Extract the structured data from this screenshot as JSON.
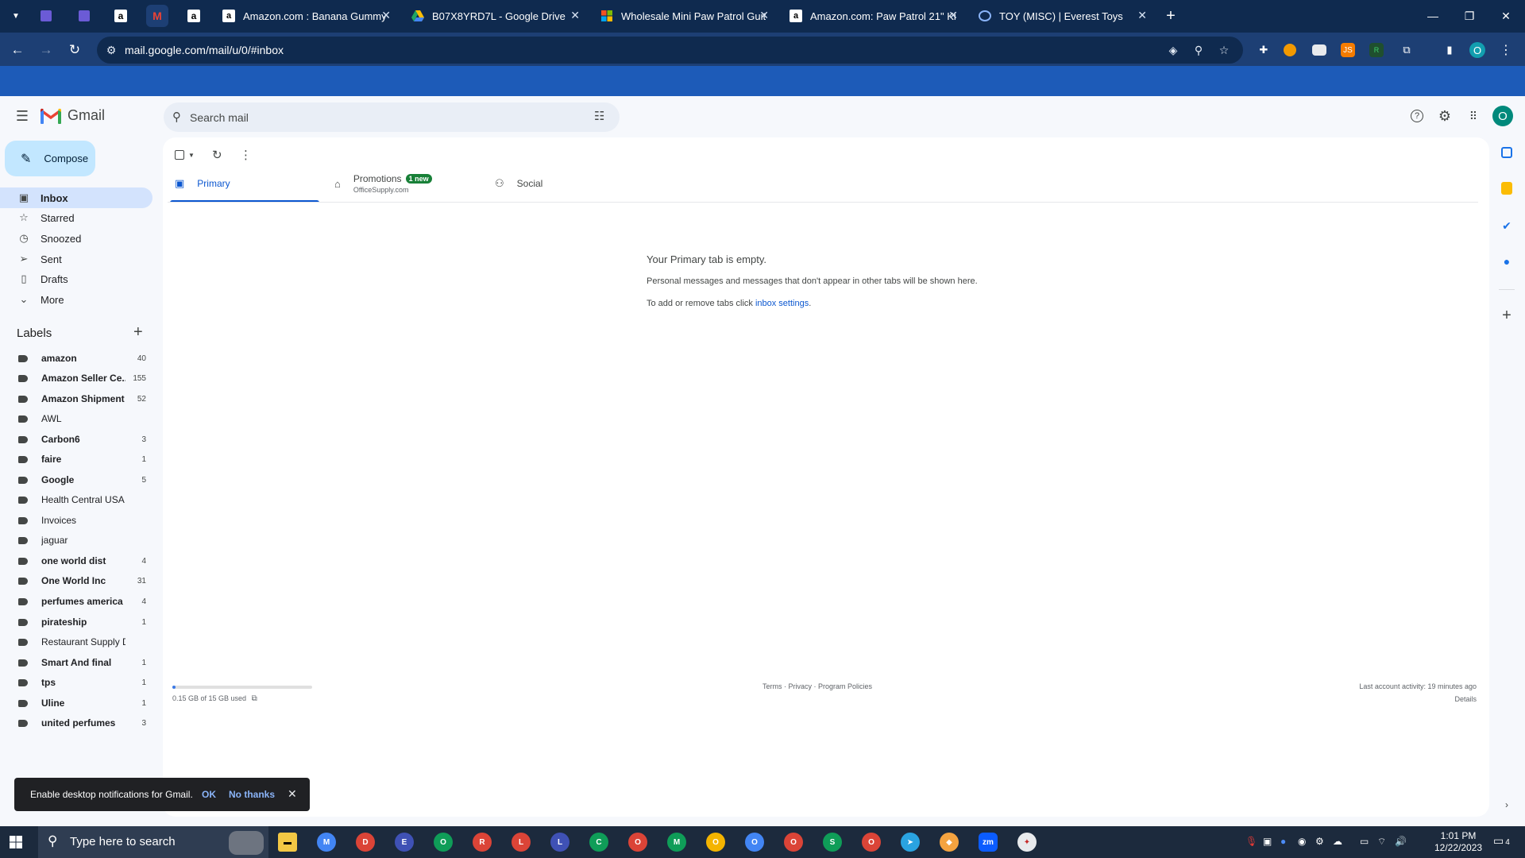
{
  "browser": {
    "tabs": [
      {
        "title": "Amazon.com : Banana Gummy",
        "favicon": "amazon-icon"
      },
      {
        "title": "B07X8YRD7L - Google Drive",
        "favicon": "google-drive-icon"
      },
      {
        "title": "Wholesale Mini Paw Patrol Guit",
        "favicon": "microsoft-icon"
      },
      {
        "title": "Amazon.com: Paw Patrol 21\" Ki",
        "favicon": "amazon-icon"
      },
      {
        "title": "TOY (MISC) | Everest Toys",
        "favicon": "everest-icon"
      }
    ],
    "url": "mail.google.com/mail/u/0/#inbox",
    "profile_initial": "O"
  },
  "gmail": {
    "logo_text": "Gmail",
    "search_placeholder": "Search mail",
    "avatar_initial": "O",
    "compose_label": "Compose",
    "nav": [
      {
        "label": "Inbox",
        "icon": "inbox-icon"
      },
      {
        "label": "Starred",
        "icon": "star-icon"
      },
      {
        "label": "Snoozed",
        "icon": "clock-icon"
      },
      {
        "label": "Sent",
        "icon": "send-icon"
      },
      {
        "label": "Drafts",
        "icon": "draft-icon"
      },
      {
        "label": "More",
        "icon": "chevron-down-icon"
      }
    ],
    "labels_heading": "Labels",
    "labels": [
      {
        "name": "amazon",
        "count": "40",
        "bold": true
      },
      {
        "name": "Amazon Seller Ce...",
        "count": "155",
        "bold": true
      },
      {
        "name": "Amazon Shipment",
        "count": "52",
        "bold": true
      },
      {
        "name": "AWL",
        "count": "",
        "bold": false
      },
      {
        "name": "Carbon6",
        "count": "3",
        "bold": true
      },
      {
        "name": "faire",
        "count": "1",
        "bold": true
      },
      {
        "name": "Google",
        "count": "5",
        "bold": true
      },
      {
        "name": "Health Central USA",
        "count": "",
        "bold": false
      },
      {
        "name": "Invoices",
        "count": "",
        "bold": false
      },
      {
        "name": "jaguar",
        "count": "",
        "bold": false
      },
      {
        "name": "one world dist",
        "count": "4",
        "bold": true
      },
      {
        "name": "One World Inc",
        "count": "31",
        "bold": true
      },
      {
        "name": "perfumes america",
        "count": "4",
        "bold": true
      },
      {
        "name": "pirateship",
        "count": "1",
        "bold": true
      },
      {
        "name": "Restaurant Supply D",
        "count": "",
        "bold": false
      },
      {
        "name": "Smart And final",
        "count": "1",
        "bold": true
      },
      {
        "name": "tps",
        "count": "1",
        "bold": true
      },
      {
        "name": "Uline",
        "count": "1",
        "bold": true
      },
      {
        "name": "united perfumes",
        "count": "3",
        "bold": true
      }
    ],
    "tabs": {
      "primary": "Primary",
      "promotions": "Promotions",
      "promotions_badge": "1 new",
      "promotions_sub": "OfficeSupply.com",
      "social": "Social"
    },
    "empty": {
      "title": "Your Primary tab is empty.",
      "line1": "Personal messages and messages that don't appear in other tabs will be shown here.",
      "line2_prefix": "To add or remove tabs click ",
      "line2_link": "inbox settings",
      "line2_suffix": "."
    },
    "storage": {
      "text": "0.15 GB of 15 GB used",
      "fraction": 0.01
    },
    "footer": {
      "terms": "Terms",
      "dot1": " · ",
      "privacy": "Privacy",
      "dot2": " · ",
      "policies": "Program Policies",
      "activity": "Last account activity: 19 minutes ago",
      "details": "Details"
    },
    "snackbar": {
      "message": "Enable desktop notifications for Gmail.",
      "ok": "OK",
      "no_thanks": "No thanks"
    }
  },
  "taskbar": {
    "search_placeholder": "Type here to search",
    "time": "1:01 PM",
    "date": "12/22/2023",
    "notification_count": "4"
  }
}
